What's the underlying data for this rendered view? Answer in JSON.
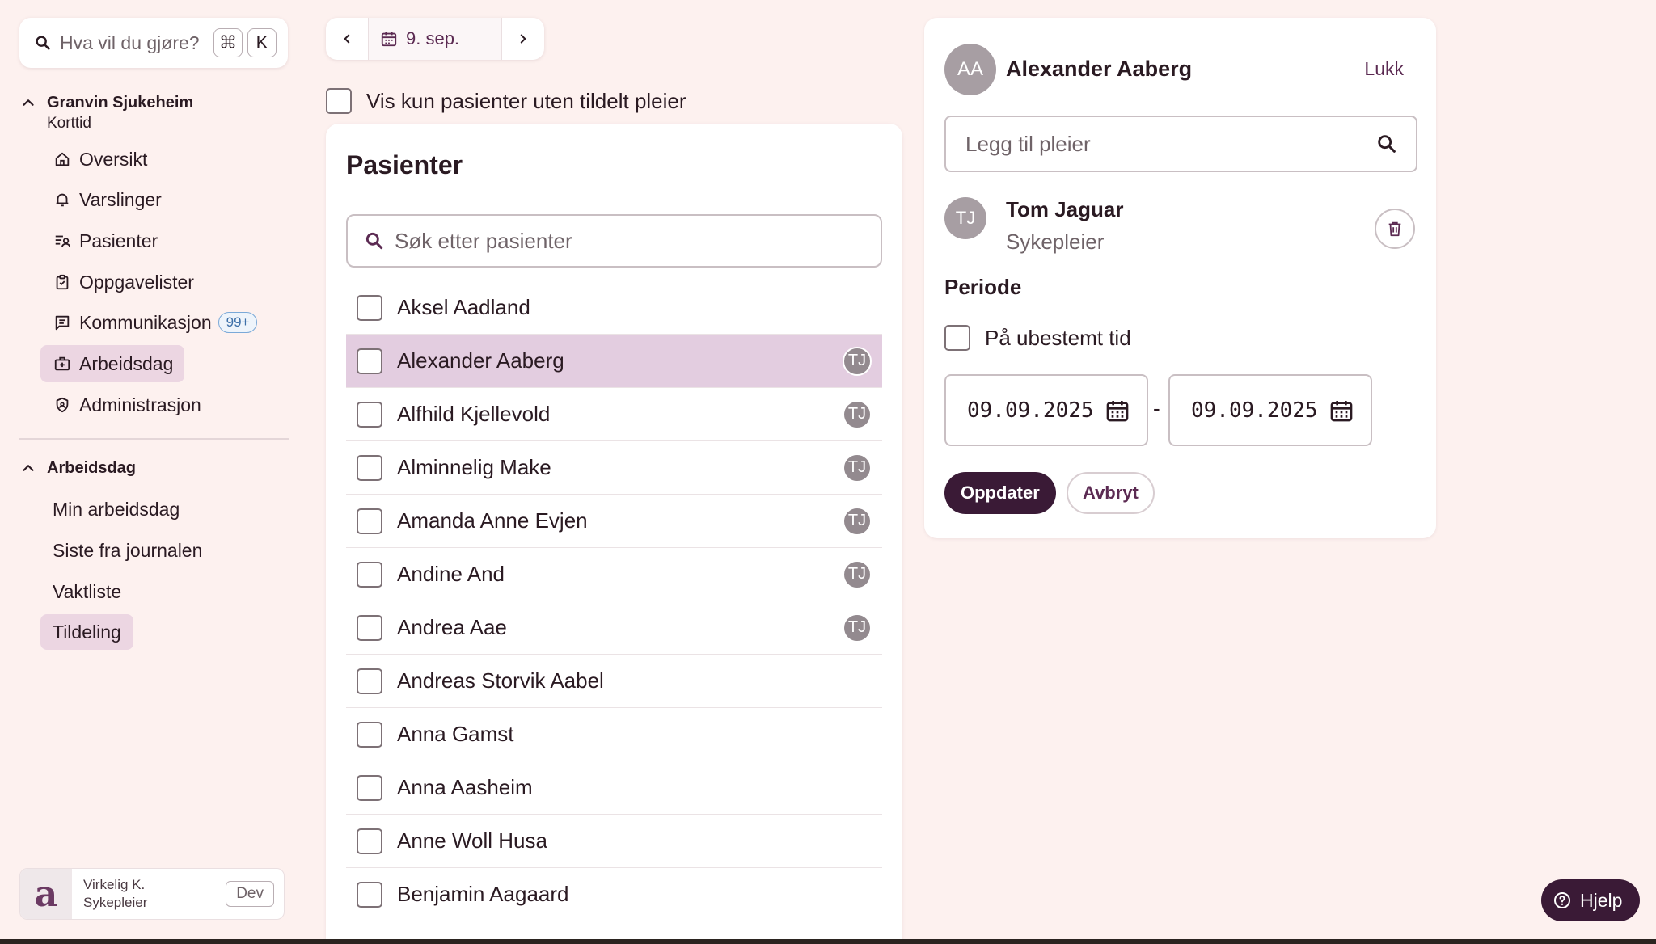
{
  "command": {
    "placeholder": "Hva vil du gjøre?",
    "key_cmd": "⌘",
    "key_k": "K"
  },
  "org": {
    "name": "Granvin Sjukeheim",
    "unit": "Korttid"
  },
  "nav": [
    {
      "label": "Oversikt"
    },
    {
      "label": "Varslinger"
    },
    {
      "label": "Pasienter"
    },
    {
      "label": "Oppgavelister"
    },
    {
      "label": "Kommunikasjon",
      "badge": "99+"
    },
    {
      "label": "Arbeidsdag"
    },
    {
      "label": "Administrasjon"
    }
  ],
  "workday": {
    "title": "Arbeidsdag",
    "items": [
      {
        "label": "Min arbeidsdag"
      },
      {
        "label": "Siste fra journalen"
      },
      {
        "label": "Vaktliste"
      },
      {
        "label": "Tildeling"
      }
    ]
  },
  "user": {
    "logo": "a",
    "name": "Virkelig K.",
    "role": "Sykepleier",
    "env": "Dev"
  },
  "date_nav": {
    "label": "9. sep."
  },
  "filter": {
    "label": "Vis kun pasienter uten tildelt pleier"
  },
  "patients": {
    "title": "Pasienter",
    "search_placeholder": "Søk etter pasienter",
    "rows": [
      {
        "name": "Aksel Aadland",
        "nurse": ""
      },
      {
        "name": "Alexander Aaberg",
        "nurse": "TJ"
      },
      {
        "name": "Alfhild Kjellevold",
        "nurse": "TJ"
      },
      {
        "name": "Alminnelig Make",
        "nurse": "TJ"
      },
      {
        "name": "Amanda Anne Evjen",
        "nurse": "TJ"
      },
      {
        "name": "Andine And",
        "nurse": "TJ"
      },
      {
        "name": "Andrea Aae",
        "nurse": "TJ"
      },
      {
        "name": "Andreas Storvik Aabel",
        "nurse": ""
      },
      {
        "name": "Anna Gamst",
        "nurse": ""
      },
      {
        "name": "Anna Aasheim",
        "nurse": ""
      },
      {
        "name": "Anne Woll Husa",
        "nurse": ""
      },
      {
        "name": "Benjamin Aagaard",
        "nurse": ""
      }
    ]
  },
  "detail": {
    "initials": "AA",
    "name": "Alexander Aaberg",
    "close": "Lukk",
    "nurse_search_placeholder": "Legg til pleier",
    "nurse": {
      "initials": "TJ",
      "name": "Tom Jaguar",
      "role": "Sykepleier"
    },
    "period_title": "Periode",
    "indefinite_label": "På ubestemt tid",
    "from": "09.09.2025",
    "separator": "-",
    "to": "09.09.2025",
    "update": "Oppdater",
    "cancel": "Avbryt"
  },
  "help": {
    "label": "Hjelp"
  }
}
